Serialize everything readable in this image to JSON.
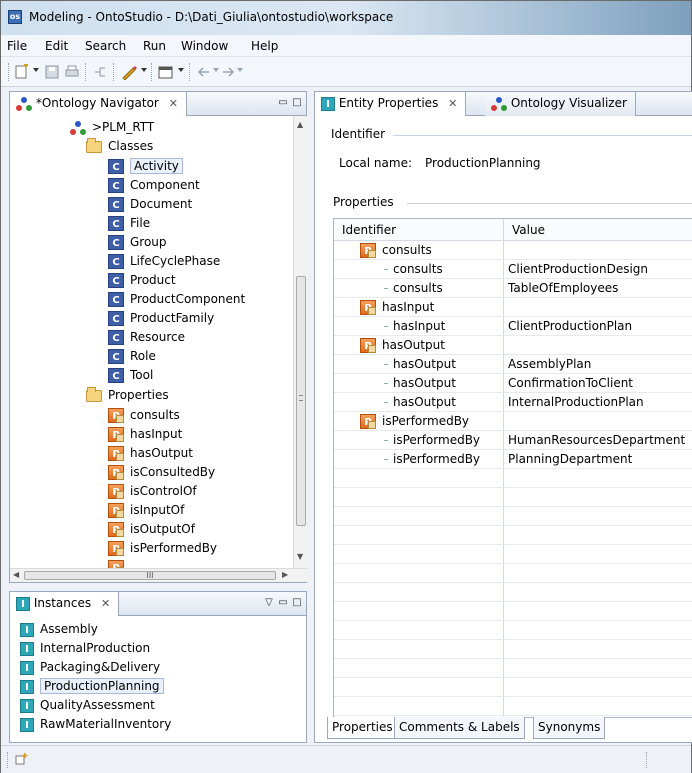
{
  "window": {
    "title": "Modeling - OntoStudio - D:\\Dati_Giulia\\ontostudio\\workspace"
  },
  "menu": [
    "File",
    "Edit",
    "Search",
    "Run",
    "Window",
    "Help"
  ],
  "navigator": {
    "tab_label": "*Ontology Navigator",
    "ontology": ">PLM_RTT",
    "classes_label": "Classes",
    "classes": [
      "Activity",
      "Component",
      "Document",
      "File",
      "Group",
      "LifeCyclePhase",
      "Product",
      "ProductComponent",
      "ProductFamily",
      "Resource",
      "Role",
      "Tool"
    ],
    "properties_label": "Properties",
    "properties": [
      "consults",
      "hasInput",
      "hasOutput",
      "isConsultedBy",
      "isControlOf",
      "isInputOf",
      "isOutputOf",
      "isPerformedBy"
    ],
    "selected_class": "Activity",
    "hscroll_label": "III"
  },
  "instances": {
    "tab_label": "Instances",
    "items": [
      "Assembly",
      "InternalProduction",
      "Packaging&Delivery",
      "ProductionPlanning",
      "QualityAssessment",
      "RawMaterialInventory"
    ],
    "selected": "ProductionPlanning"
  },
  "entity": {
    "tab_label": "Entity Properties",
    "tab2_label": "Ontology Visualizer",
    "identifier_section": "Identifier",
    "local_name_label": "Local name:",
    "local_name_value": "ProductionPlanning",
    "properties_section": "Properties",
    "col_identifier": "Identifier",
    "col_value": "Value",
    "rows": [
      {
        "kind": "group",
        "id": "consults",
        "value": ""
      },
      {
        "kind": "child",
        "id": "consults",
        "value": "ClientProductionDesign"
      },
      {
        "kind": "child",
        "id": "consults",
        "value": "TableOfEmployees"
      },
      {
        "kind": "group",
        "id": "hasInput",
        "value": ""
      },
      {
        "kind": "child",
        "id": "hasInput",
        "value": "ClientProductionPlan"
      },
      {
        "kind": "group",
        "id": "hasOutput",
        "value": ""
      },
      {
        "kind": "child",
        "id": "hasOutput",
        "value": "AssemblyPlan"
      },
      {
        "kind": "child",
        "id": "hasOutput",
        "value": "ConfirmationToClient"
      },
      {
        "kind": "child",
        "id": "hasOutput",
        "value": "InternalProductionPlan"
      },
      {
        "kind": "group",
        "id": "isPerformedBy",
        "value": ""
      },
      {
        "kind": "child",
        "id": "isPerformedBy",
        "value": "HumanResourcesDepartment"
      },
      {
        "kind": "child",
        "id": "isPerformedBy",
        "value": "PlanningDepartment"
      }
    ],
    "bottom_tabs": [
      "Properties",
      "Comments & Labels",
      "Synonyms"
    ]
  },
  "icons": {
    "class": "class-icon",
    "property": "property-icon",
    "instance": "instance-icon",
    "folder": "folder-icon",
    "ontology": "ontology-icon"
  },
  "colors": {
    "class_icon": "#3f5ea8",
    "property_icon": "#e06b1c",
    "instance_icon": "#2ea7b8",
    "view_border": "#99a8bc"
  }
}
